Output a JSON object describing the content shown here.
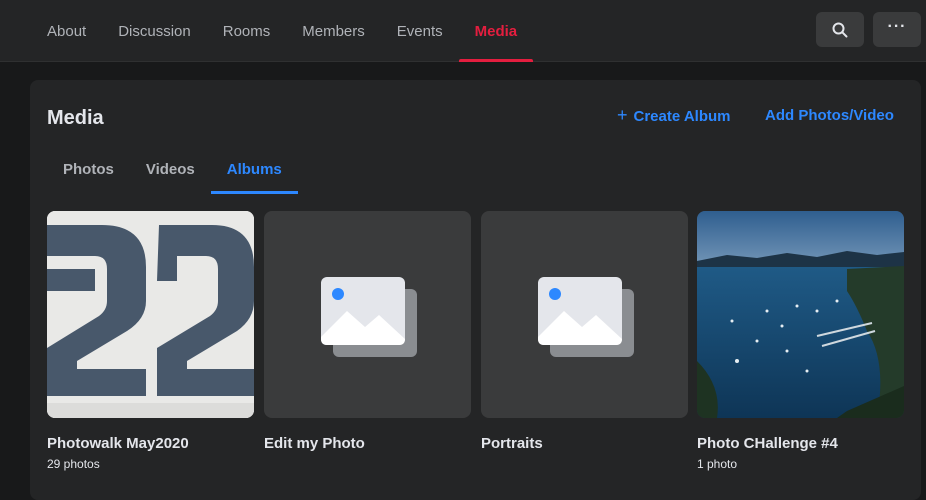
{
  "topnav": {
    "tabs": [
      {
        "label": "About",
        "active": false
      },
      {
        "label": "Discussion",
        "active": false
      },
      {
        "label": "Rooms",
        "active": false
      },
      {
        "label": "Members",
        "active": false
      },
      {
        "label": "Events",
        "active": false
      },
      {
        "label": "Media",
        "active": true
      }
    ],
    "search_icon": "search-icon",
    "more_label": "···",
    "accent_color": "#e41e3f"
  },
  "media": {
    "title": "Media",
    "create_album_label": "Create Album",
    "add_photos_label": "Add Photos/Video",
    "link_color": "#2d88ff",
    "subtabs": [
      {
        "label": "Photos",
        "active": false
      },
      {
        "label": "Videos",
        "active": false
      },
      {
        "label": "Albums",
        "active": true
      }
    ],
    "albums": [
      {
        "name": "Photowalk May2020",
        "count": "29 photos",
        "thumb": "number-22-photo"
      },
      {
        "name": "Edit my Photo",
        "count": "",
        "thumb": "placeholder-image-icon"
      },
      {
        "name": "Portraits",
        "count": "",
        "thumb": "placeholder-image-icon"
      },
      {
        "name": "Photo CHallenge #4",
        "count": "1 photo",
        "thumb": "harbor-photo"
      }
    ]
  }
}
